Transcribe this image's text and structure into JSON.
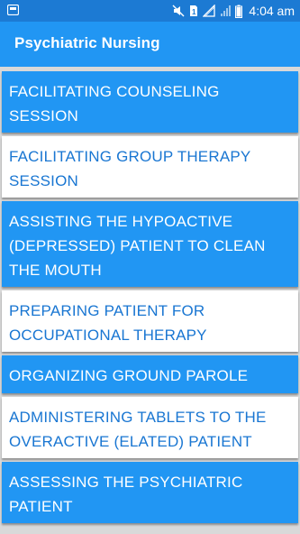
{
  "status_bar": {
    "time": "4:04 am"
  },
  "app_bar": {
    "title": "Psychiatric Nursing"
  },
  "colors": {
    "status_bar": "#1c7ad3",
    "app_bar": "#2196f3",
    "item_blue": "#2196f3",
    "item_white_text": "#1976d2"
  },
  "list": {
    "items": [
      {
        "label": "FACILITATING COUNSELING SESSION"
      },
      {
        "label": "FACILITATING GROUP THERAPY SESSION"
      },
      {
        "label": "ASSISTING THE HYPOACTIVE (DEPRESSED) PATIENT TO CLEAN THE MOUTH"
      },
      {
        "label": "PREPARING PATIENT FOR OCCUPATIONAL THERAPY"
      },
      {
        "label": "ORGANIZING GROUND PAROLE"
      },
      {
        "label": "ADMINISTERING TABLETS TO THE OVERACTIVE (ELATED) PATIENT"
      },
      {
        "label": "ASSESSING THE PSYCHIATRIC PATIENT"
      }
    ]
  }
}
